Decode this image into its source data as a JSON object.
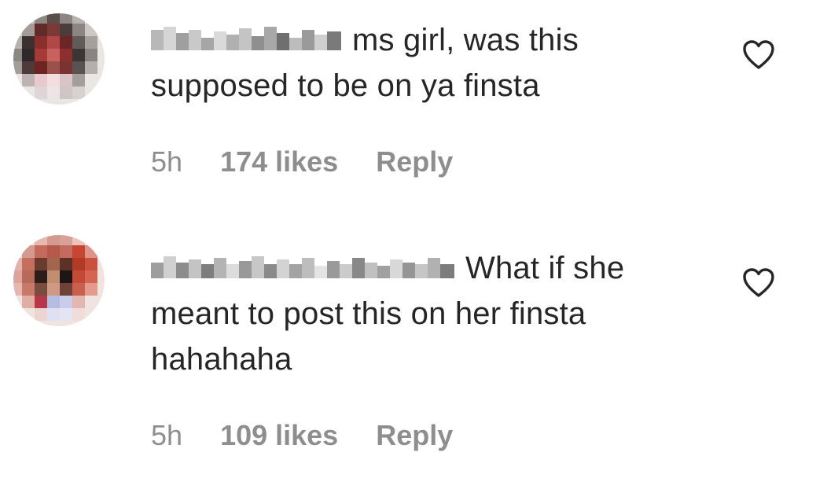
{
  "comments": [
    {
      "username": "",
      "text": "ms girl, was this supposed to be on ya finsta",
      "time": "5h",
      "likes": "174 likes",
      "reply_label": "Reply",
      "like_icon": "heart-outline-icon"
    },
    {
      "username": "",
      "text": "What if she meant to post this on her finsta hahahaha",
      "time": "5h",
      "likes": "109 likes",
      "reply_label": "Reply",
      "like_icon": "heart-outline-icon"
    }
  ],
  "colors": {
    "text": "#262626",
    "meta": "#8e8e8e",
    "icon": "#262626"
  }
}
